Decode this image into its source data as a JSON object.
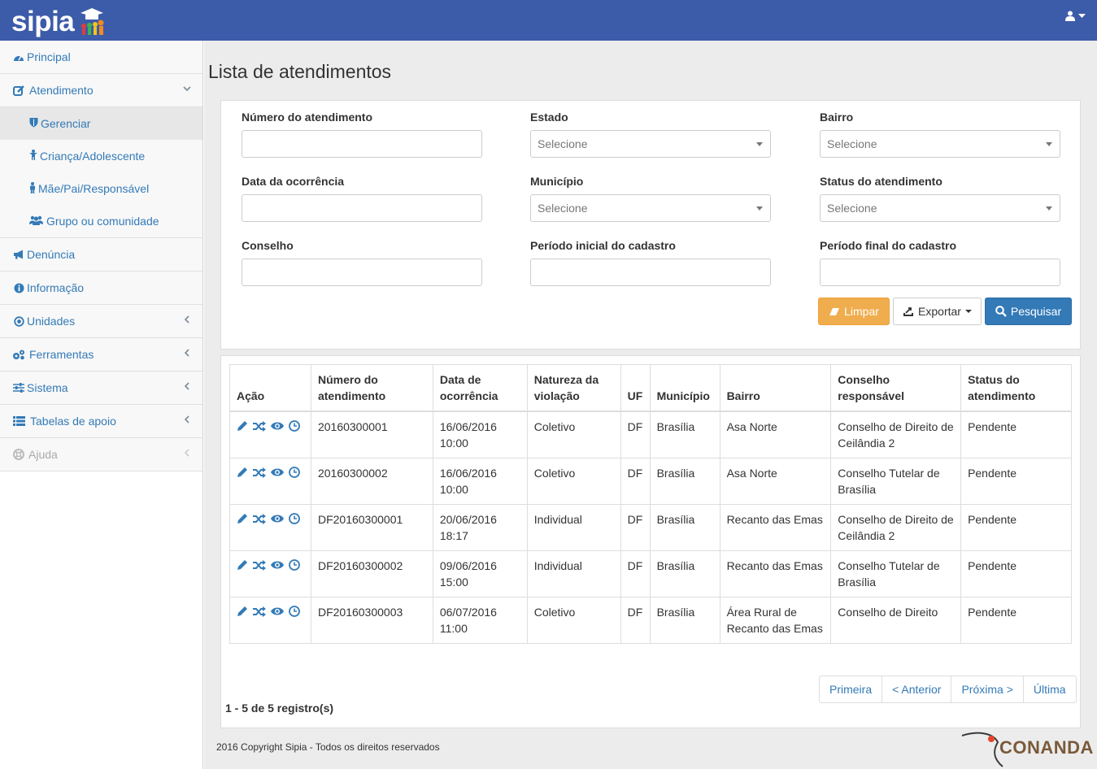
{
  "app": {
    "logo_text": "sipia"
  },
  "sidebar": {
    "items": [
      {
        "label": "Principal",
        "icon": "dashboard-icon"
      },
      {
        "label": "Atendimento",
        "icon": "edit-icon"
      },
      {
        "label": "Gerenciar",
        "icon": "shield-icon"
      },
      {
        "label": "Criança/Adolescente",
        "icon": "child-icon"
      },
      {
        "label": "Mãe/Pai/Responsável",
        "icon": "male-icon"
      },
      {
        "label": "Grupo ou comunidade",
        "icon": "users-icon"
      },
      {
        "label": "Denúncia",
        "icon": "bullhorn-icon"
      },
      {
        "label": "Informação",
        "icon": "info-icon"
      },
      {
        "label": "Unidades",
        "icon": "dot-circle-icon"
      },
      {
        "label": "Ferramentas",
        "icon": "cogs-icon"
      },
      {
        "label": "Sistema",
        "icon": "sliders-icon"
      },
      {
        "label": "Tabelas de apoio",
        "icon": "list-icon"
      },
      {
        "label": "Ajuda",
        "icon": "life-ring-icon"
      }
    ]
  },
  "page": {
    "title": "Lista de atendimentos"
  },
  "filters": {
    "numero": {
      "label": "Número do atendimento",
      "value": ""
    },
    "estado": {
      "label": "Estado",
      "value": "Selecione"
    },
    "bairro": {
      "label": "Bairro",
      "value": "Selecione"
    },
    "data_ocorrencia": {
      "label": "Data da ocorrência",
      "value": ""
    },
    "municipio": {
      "label": "Município",
      "value": "Selecione"
    },
    "status": {
      "label": "Status do atendimento",
      "value": "Selecione"
    },
    "conselho": {
      "label": "Conselho",
      "value": ""
    },
    "periodo_inicial": {
      "label": "Período inicial do cadastro",
      "value": ""
    },
    "periodo_final": {
      "label": "Período final do cadastro",
      "value": ""
    }
  },
  "buttons": {
    "limpar": "Limpar",
    "exportar": "Exportar",
    "pesquisar": "Pesquisar"
  },
  "table": {
    "headers": [
      "Ação",
      "Número do atendimento",
      "Data de ocorrência",
      "Natureza da violação",
      "UF",
      "Município",
      "Bairro",
      "Conselho responsável",
      "Status do atendimento"
    ],
    "rows": [
      {
        "numero": "20160300001",
        "data": "16/06/2016 10:00",
        "natureza": "Coletivo",
        "uf": "DF",
        "municipio": "Brasília",
        "bairro": "Asa Norte",
        "conselho": "Conselho de Direito de Ceilândia 2",
        "status": "Pendente"
      },
      {
        "numero": "20160300002",
        "data": "16/06/2016 10:00",
        "natureza": "Coletivo",
        "uf": "DF",
        "municipio": "Brasília",
        "bairro": "Asa Norte",
        "conselho": "Conselho Tutelar de Brasília",
        "status": "Pendente"
      },
      {
        "numero": "DF20160300001",
        "data": "20/06/2016 18:17",
        "natureza": "Individual",
        "uf": "DF",
        "municipio": "Brasília",
        "bairro": "Recanto das Emas",
        "conselho": "Conselho de Direito de Ceilândia 2",
        "status": "Pendente"
      },
      {
        "numero": "DF20160300002",
        "data": "09/06/2016 15:00",
        "natureza": "Individual",
        "uf": "DF",
        "municipio": "Brasília",
        "bairro": "Recanto das Emas",
        "conselho": "Conselho Tutelar de Brasília",
        "status": "Pendente"
      },
      {
        "numero": "DF20160300003",
        "data": "06/07/2016 11:00",
        "natureza": "Coletivo",
        "uf": "DF",
        "municipio": "Brasília",
        "bairro": "Área Rural de Recanto das Emas",
        "conselho": "Conselho de Direito",
        "status": "Pendente"
      }
    ],
    "row_actions": [
      "pencil-icon",
      "random-icon",
      "eye-icon",
      "clock-icon"
    ]
  },
  "pagination": {
    "summary": "1 - 5 de 5 registro(s)",
    "first": "Primeira",
    "prev": "< Anterior",
    "next": "Próxima >",
    "last": "Última"
  },
  "footer": {
    "copyright": "2016 Copyright Sipia - Todos os direitos reservados",
    "partner_logo": "CONANDA"
  },
  "colors": {
    "topbar": "#3c5ba9",
    "link": "#337ab7",
    "warning": "#f0ad4e",
    "primary": "#337ab7"
  }
}
